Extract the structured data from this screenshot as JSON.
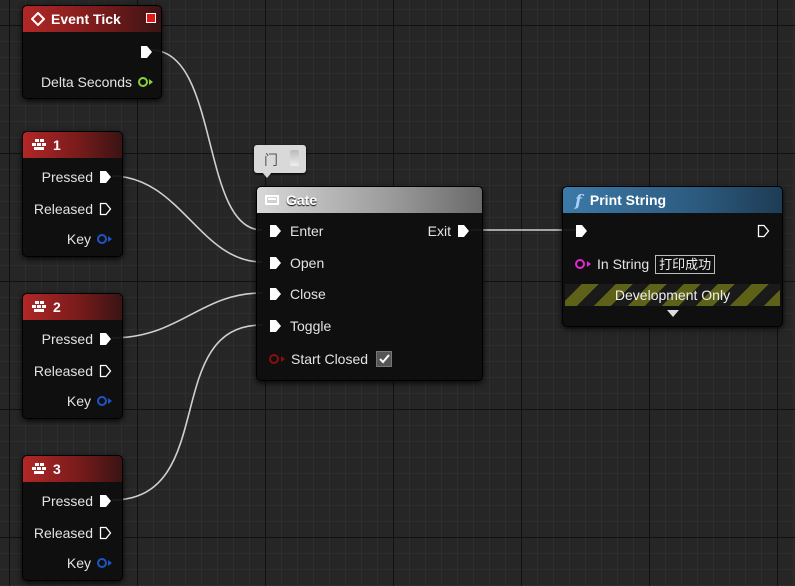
{
  "event_tick": {
    "title": "Event Tick",
    "delta_label": "Delta Seconds"
  },
  "key_nodes": [
    {
      "title": "1",
      "pressed": "Pressed",
      "released": "Released",
      "key": "Key"
    },
    {
      "title": "2",
      "pressed": "Pressed",
      "released": "Released",
      "key": "Key"
    },
    {
      "title": "3",
      "pressed": "Pressed",
      "released": "Released",
      "key": "Key"
    }
  ],
  "gate": {
    "comment": "门",
    "title": "Gate",
    "enter": "Enter",
    "open": "Open",
    "close": "Close",
    "toggle": "Toggle",
    "start_closed": "Start Closed",
    "start_closed_checked": true,
    "exit": "Exit"
  },
  "print_string": {
    "title": "Print String",
    "in_string_label": "In String",
    "in_string_value": "打印成功",
    "dev_only": "Development Only"
  },
  "colors": {
    "event_header": "#b22727",
    "function_header": "#3c79a8",
    "float_pin": "#8ad138",
    "struct_pin": "#1b56c4",
    "string_pin": "#e22ad0",
    "bool_pin": "#8a0f0f"
  },
  "icons": {
    "event": "event-diamond-icon",
    "key": "keyboard-icon",
    "gate": "gate-icon",
    "function": "function-f-icon",
    "comment": "comment-bubble-icon"
  }
}
